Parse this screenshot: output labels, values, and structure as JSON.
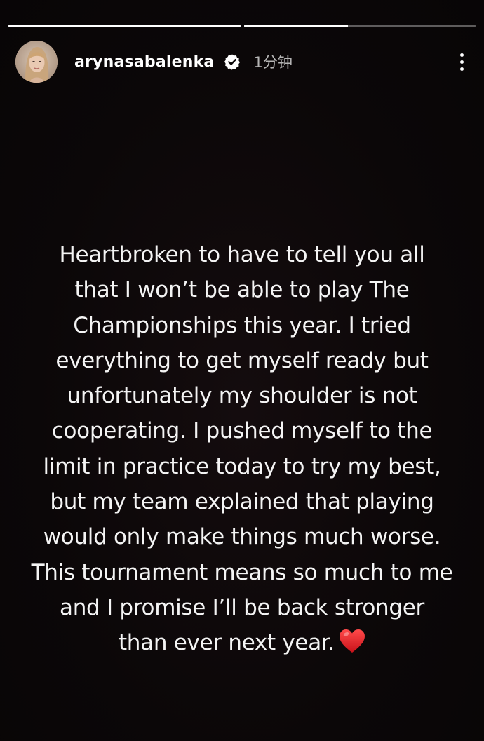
{
  "story_progress": {
    "segments": [
      {
        "fill": 1.0
      },
      {
        "fill": 0.45
      }
    ]
  },
  "header": {
    "username": "arynasabalenka",
    "verified": true,
    "timestamp": "1分钟"
  },
  "story": {
    "lines": [
      "Heartbroken to have to tell you all",
      "that I won’t be able to play The",
      "Championships this year. I tried",
      "everything to get myself ready but",
      "unfortunately my shoulder is not",
      "cooperating. I pushed myself to the",
      "limit in practice today to try my best,",
      "but my team explained that playing",
      "would only make things much worse.",
      "This tournament means so much to me",
      "and I promise I’ll be back stronger",
      "than ever next year."
    ],
    "emoji": "red-heart-icon"
  },
  "colors": {
    "background": "#0b0708",
    "text": "#f4f4f4",
    "heart": "#e0191f"
  }
}
